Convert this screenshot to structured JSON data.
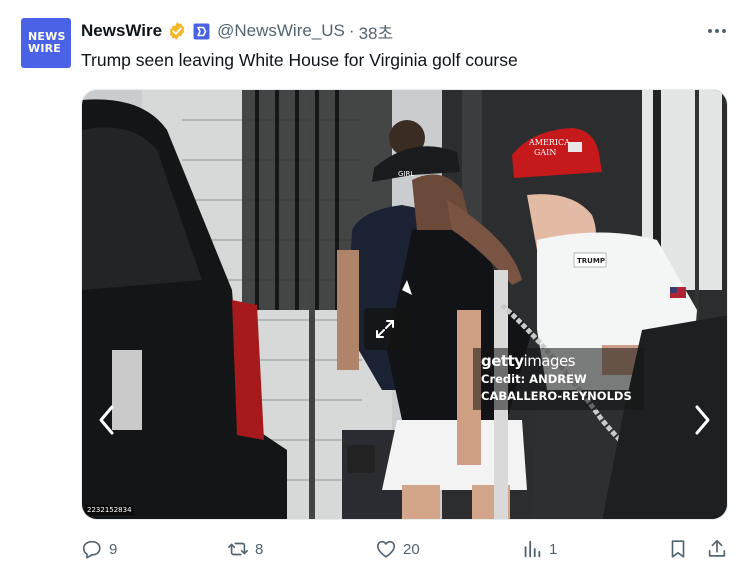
{
  "tweet": {
    "avatar": {
      "line1": "NEWS",
      "line2": "WIRE",
      "bg": "#4a63e6"
    },
    "display_name": "NewsWire",
    "handle": "@NewsWire_US",
    "separator": "·",
    "time": "38초",
    "text": "Trump seen leaving White House for Virginia golf course",
    "icons": {
      "verified": "verified-badge-icon",
      "affiliation": "affiliate-badge-icon",
      "more": "more-horizontal-icon"
    }
  },
  "media": {
    "watermark": {
      "logo_bold": "getty",
      "logo_light": "images",
      "credit_line1": "Credit: ANDREW",
      "credit_line2": "CABALLERO-REYNOLDS"
    },
    "image_id": "2232152834",
    "cap_text_line1": "AMERICA",
    "cap_text_line2": "GAIN",
    "shirt_logo": "TRUMP",
    "hat_text": "GIRL"
  },
  "actions": {
    "reply": {
      "icon": "reply-icon",
      "count": "9"
    },
    "repost": {
      "icon": "repost-icon",
      "count": "8"
    },
    "like": {
      "icon": "like-icon",
      "count": "20"
    },
    "views": {
      "icon": "views-icon",
      "count": "1"
    },
    "bookmark": {
      "icon": "bookmark-icon"
    },
    "share": {
      "icon": "share-icon"
    }
  },
  "colors": {
    "text": "#0f1419",
    "secondary": "#536471",
    "verified": "#f4b72c",
    "brand": "#4a63e6"
  }
}
